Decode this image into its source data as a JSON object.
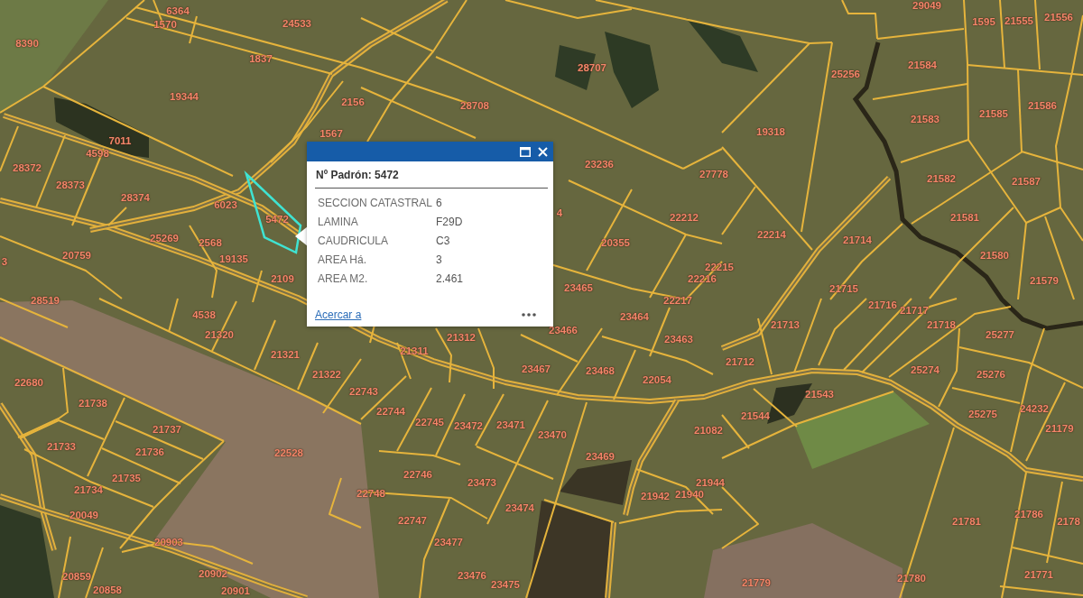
{
  "map": {
    "parcel_labels": [
      "6364",
      "29049",
      "1570",
      "24533",
      "1595",
      "21555",
      "21556",
      "8390",
      "1837",
      "28707",
      "25256",
      "21584",
      "19344",
      "2156",
      "28708",
      "21583",
      "21585",
      "21586",
      "7011",
      "1567",
      "19318",
      "4598",
      "28372",
      "23236",
      "28373",
      "27778",
      "21582",
      "21587",
      "28374",
      "6023",
      "5472",
      "4",
      "22212",
      "21581",
      "25269",
      "2568",
      "20355",
      "22214",
      "21714",
      "3",
      "20759",
      "19135",
      "22215",
      "21580",
      "2109",
      "23465",
      "22216",
      "21715",
      "21579",
      "28519",
      "4538",
      "23464",
      "22217",
      "21716",
      "21717",
      "21320",
      "21312",
      "23466",
      "23463",
      "21713",
      "21718",
      "25277",
      "22680",
      "21321",
      "21322",
      "21311",
      "23467",
      "23468",
      "22054",
      "21712",
      "25274",
      "25276",
      "21738",
      "21737",
      "22743",
      "22744",
      "22745",
      "23472",
      "23471",
      "23470",
      "21082",
      "21544",
      "21543",
      "25275",
      "24232",
      "21179",
      "21733",
      "21736",
      "22528",
      "23469",
      "21734",
      "21735",
      "22748",
      "22746",
      "23473",
      "21942",
      "21940",
      "21944",
      "20049",
      "22747",
      "23474",
      "21781",
      "21786",
      "2178",
      "20903",
      "23477",
      "20859",
      "20858",
      "20902",
      "20901",
      "23476",
      "23475",
      "21779",
      "21780",
      "21771"
    ]
  },
  "popup": {
    "title": "Nº Padrón: 5472",
    "fields": [
      {
        "label": "SECCION CATASTRAL",
        "value": "6"
      },
      {
        "label": "LAMINA",
        "value": "F29D"
      },
      {
        "label": "CAUDRICULA",
        "value": "C3"
      },
      {
        "label": "AREA Há.",
        "value": "3"
      },
      {
        "label": "AREA M2.",
        "value": "2.461"
      }
    ],
    "footer_link": "Acercar a"
  }
}
